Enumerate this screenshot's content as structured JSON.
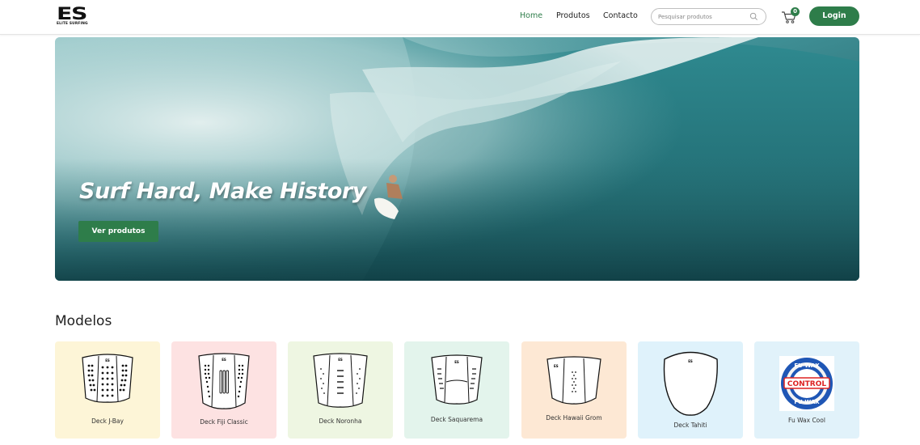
{
  "header": {
    "logo_mark": "ES",
    "logo_sub": "ELITE SURFING",
    "nav": [
      {
        "label": "Home",
        "active": true
      },
      {
        "label": "Produtos",
        "active": false
      },
      {
        "label": "Contacto",
        "active": false
      }
    ],
    "search": {
      "placeholder": "Pesquisar produtos",
      "icon": "search-icon"
    },
    "cart": {
      "icon": "cart-icon",
      "count": "0"
    },
    "login_label": "Login"
  },
  "hero": {
    "title": "Surf Hard, Make History",
    "button_label": "Ver produtos"
  },
  "models": {
    "title": "Modelos",
    "items": [
      {
        "label": "Deck J-Bay",
        "bg": "#fdf5d7"
      },
      {
        "label": "Deck Fiji Classic",
        "bg": "#fde2e2"
      },
      {
        "label": "Deck Noronha",
        "bg": "#eef6e2"
      },
      {
        "label": "Deck Saquarema",
        "bg": "#e3f4ec"
      },
      {
        "label": "Deck Hawaii Grom",
        "bg": "#fde8d4"
      },
      {
        "label": "Deck Tahiti",
        "bg": "#dff2fb"
      },
      {
        "label": "Fu Wax Cool",
        "bg": "#e1f2fa"
      }
    ]
  },
  "colors": {
    "accent": "#2e7d4a"
  }
}
